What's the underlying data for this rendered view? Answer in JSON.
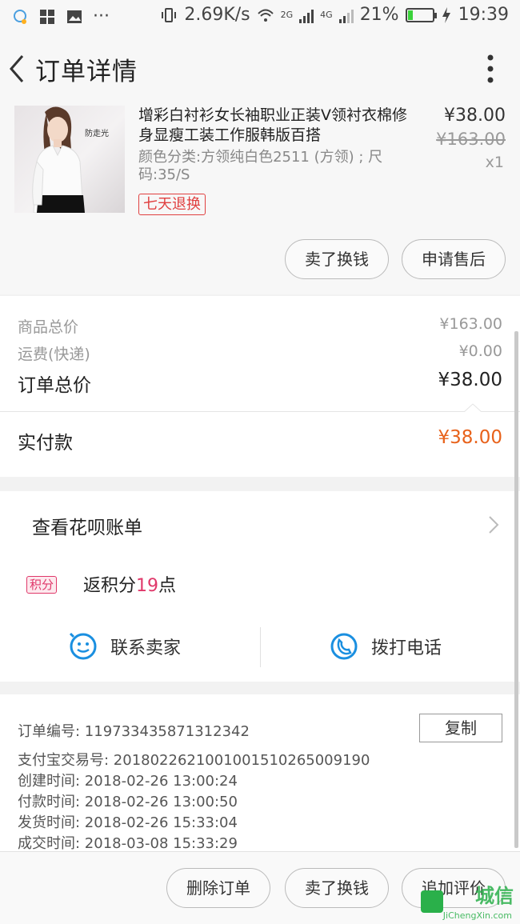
{
  "status_bar": {
    "speed": "2.69K/s",
    "net_2g": "2G",
    "net_4g": "4G",
    "battery": "21%",
    "time": "19:39",
    "ellipsis": "···",
    "battery_level": 0.21
  },
  "header": {
    "title": "订单详情"
  },
  "product": {
    "title": "增彩白衬衫女长袖职业正装V领衬衣棉修身显瘦工装工作服韩版百搭",
    "spec": "颜色分类:方领纯白色2511 (方领) ; 尺码:35/S",
    "badge": "七天退换",
    "price": "¥38.00",
    "original_price": "¥163.00",
    "quantity": "x1",
    "thumb_tag": "防走光",
    "sell_button": "卖了换钱",
    "aftersale_button": "申请售后"
  },
  "summary": {
    "goods_label": "商品总价",
    "goods_value": "¥163.00",
    "shipping_label": "运费(快递)",
    "shipping_value": "¥0.00",
    "total_label": "订单总价",
    "total_value": "¥38.00",
    "paid_label": "实付款",
    "paid_value": "¥38.00"
  },
  "huabei": {
    "title": "查看花呗账单",
    "points_badge": "积分",
    "points_prefix": "返积分",
    "points_value": "19",
    "points_suffix": "点",
    "contact_seller": "联系卖家",
    "call_phone": "拨打电话"
  },
  "order_info": {
    "order_no": "订单编号:  1197334358713123​42",
    "alipay_no": "支付宝交易号:  2018022621001001510265009190",
    "created": "创建时间:  2018-02-26  13:00:24",
    "paid": "付款时间:  2018-02-26  13:00:50",
    "shipped": "发货时间:  2018-02-26  15:33:04",
    "completed": "成交时间:  2018-03-08  15:33:29",
    "copy_button": "复制"
  },
  "bottom_bar": {
    "delete_button": "删除订单",
    "sell_button": "卖了换钱",
    "review_button": "追加评价"
  },
  "watermark": {
    "text": "城信",
    "url": "JiChengXin.com"
  },
  "colors": {
    "accent_orange": "#e8621b",
    "badge_red": "#e04040",
    "points_pink": "#e0386a",
    "icon_blue": "#1a8fe0"
  }
}
